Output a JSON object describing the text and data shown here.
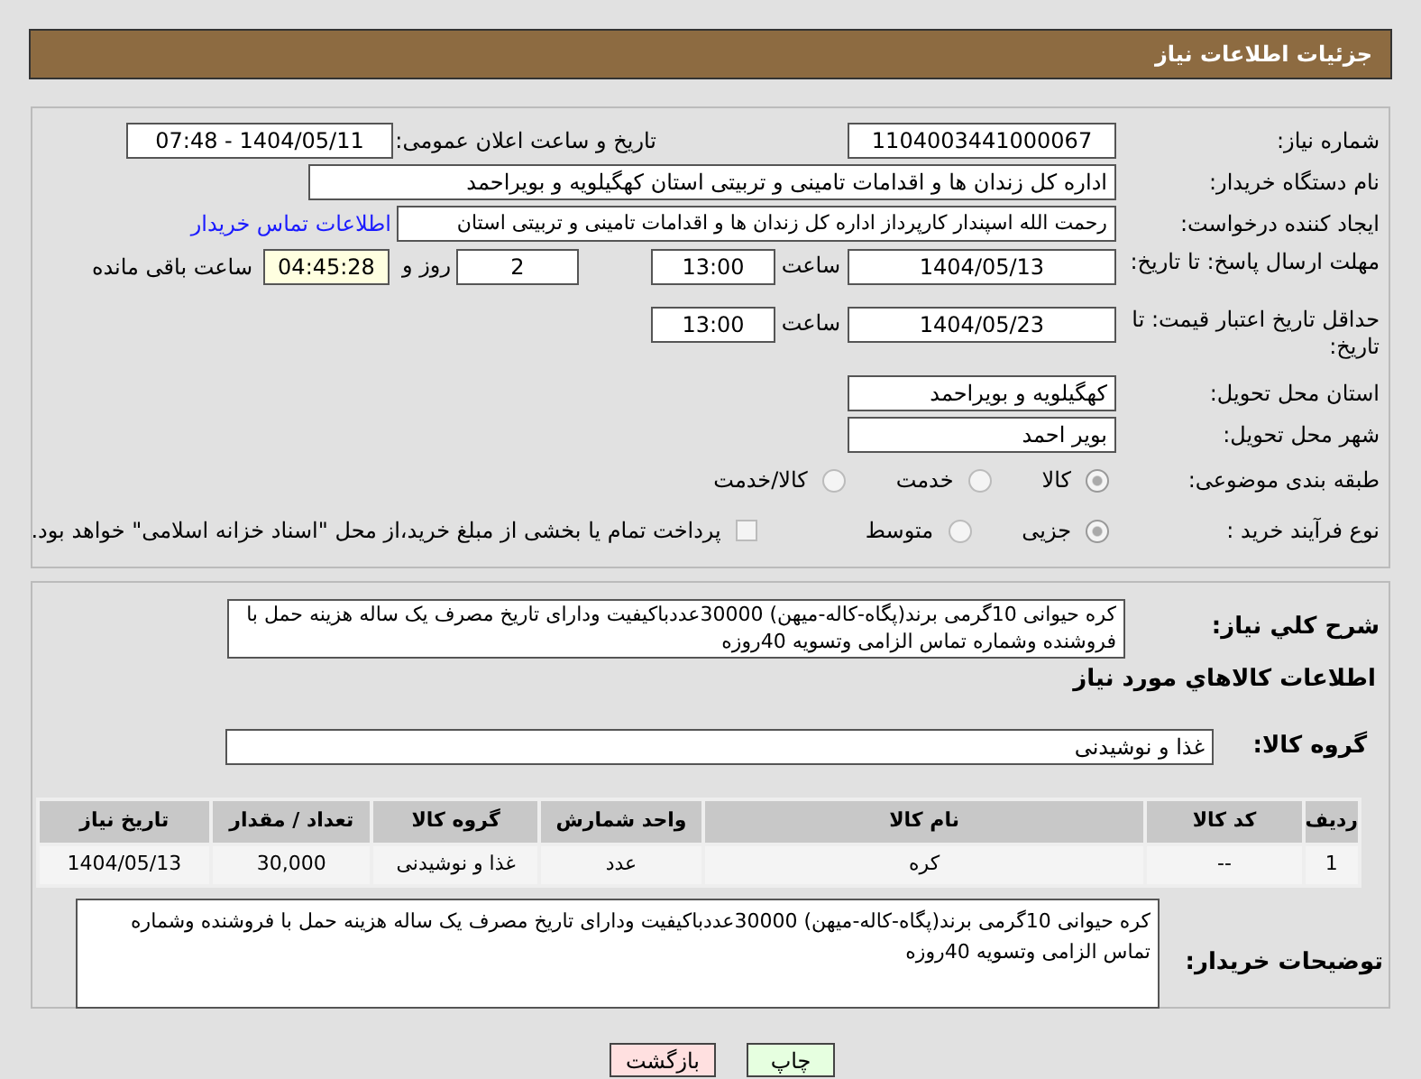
{
  "header": {
    "title": "جزئیات اطلاعات نیاز"
  },
  "need_number": {
    "label": "شماره نیاز:",
    "value": "1104003441000067"
  },
  "announce": {
    "label": "تاریخ و ساعت اعلان عمومی:",
    "value": "1404/05/11 - 07:48"
  },
  "buyer_org": {
    "label": "نام دستگاه خریدار:",
    "value": "اداره کل زندان ها و اقدامات تامینی و تربیتی استان کهگیلویه و بویراحمد"
  },
  "creator": {
    "label": "ایجاد کننده درخواست:",
    "value": "رحمت الله اسپندار کارپرداز اداره کل زندان ها و اقدامات تامینی و تربیتی استان",
    "link": "اطلاعات تماس خریدار"
  },
  "deadline": {
    "label": "مهلت ارسال پاسخ: تا تاریخ:",
    "date": "1404/05/13",
    "time_label": "ساعت",
    "time": "13:00",
    "days": "2",
    "days_label": "روز و",
    "remaining": "04:45:28",
    "remaining_label": "ساعت باقی مانده"
  },
  "validity": {
    "label": "حداقل تاریخ اعتبار قیمت: تا تاریخ:",
    "date": "1404/05/23",
    "time_label": "ساعت",
    "time": "13:00"
  },
  "province": {
    "label": "استان محل تحویل:",
    "value": "کهگیلویه و بویراحمد"
  },
  "city": {
    "label": "شهر محل تحویل:",
    "value": "بویر احمد"
  },
  "category": {
    "label": "طبقه بندی موضوعی:",
    "options": [
      {
        "label": "کالا",
        "selected": true
      },
      {
        "label": "خدمت",
        "selected": false
      },
      {
        "label": "کالا/خدمت",
        "selected": false
      }
    ]
  },
  "process": {
    "label": "نوع فرآیند خرید :",
    "options": [
      {
        "label": "جزیی",
        "selected": true
      },
      {
        "label": "متوسط",
        "selected": false
      }
    ],
    "treasury": {
      "label": "پرداخت تمام یا بخشی از مبلغ خرید،از محل \"اسناد خزانه اسلامی\" خواهد بود.",
      "checked": false
    }
  },
  "description": {
    "label": "شرح كلي نياز:",
    "value": "کره حیوانی 10گرمی برند(پگاه-کاله-میهن) 30000عددباکیفیت ودارای تاریخ مصرف یک ساله هزینه حمل با فروشنده وشماره تماس الزامی وتسویه 40روزه"
  },
  "goods_heading": "اطلاعات كالاهاي مورد نياز",
  "goods_group": {
    "label": "گروه کالا:",
    "value": "غذا و نوشیدنی"
  },
  "table": {
    "columns": [
      "ردیف",
      "کد کالا",
      "نام کالا",
      "واحد شمارش",
      "گروه کالا",
      "تعداد / مقدار",
      "تاریخ نیاز"
    ],
    "rows": [
      [
        "1",
        "--",
        "کره",
        "عدد",
        "غذا و نوشیدنی",
        "30,000",
        "1404/05/13"
      ]
    ]
  },
  "buyer_notes": {
    "label": "توضیحات خریدار:",
    "value": "کره حیوانی 10گرمی برند(پگاه-کاله-میهن) 30000عددباکیفیت ودارای تاریخ مصرف یک ساله هزینه حمل با فروشنده وشماره تماس الزامی وتسویه 40روزه"
  },
  "buttons": [
    {
      "label": "چاپ",
      "kind": "print"
    },
    {
      "label": "بازگشت",
      "kind": "back"
    }
  ]
}
